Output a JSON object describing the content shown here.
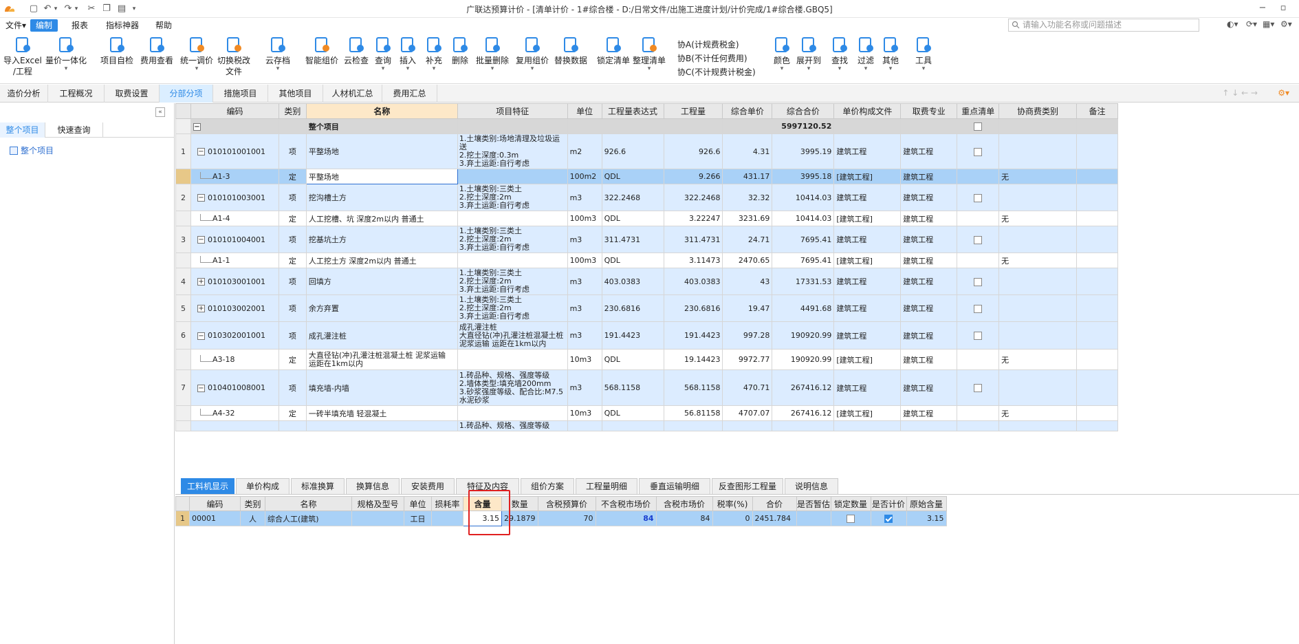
{
  "titlebar": {
    "title": "广联达预算计价 - [清单计价 - 1#综合楼 - D:/日常文件/出施工进度计划/计价完成/1#综合楼.GBQ5]"
  },
  "menubar": {
    "items": [
      "文件▾",
      "编制",
      "报表",
      "指标神器",
      "帮助"
    ],
    "search_placeholder": "请输入功能名称或问题描述"
  },
  "ribbon": {
    "buttons": [
      {
        "label1": "导入Excel",
        "label2": "/工程",
        "icon": "import-excel-icon",
        "color": "#2e8ae6"
      },
      {
        "label1": "量价一体化",
        "label2": "",
        "icon": "quantity-price-icon",
        "color": "#2e8ae6"
      },
      {
        "label1": "项目自检",
        "label2": "",
        "icon": "self-check-icon",
        "color": "#2e8ae6"
      },
      {
        "label1": "费用查看",
        "label2": "",
        "icon": "cost-view-icon",
        "color": "#2e8ae6"
      },
      {
        "label1": "统一调价",
        "label2": "",
        "icon": "unify-price-icon",
        "color": "#f08a24"
      },
      {
        "label1": "切换税改",
        "label2": "文件",
        "icon": "switch-tax-icon",
        "color": "#f08a24"
      },
      {
        "label1": "云存档",
        "label2": "",
        "icon": "cloud-save-icon",
        "color": "#2e8ae6"
      },
      {
        "label1": "智能组价",
        "label2": "",
        "icon": "smart-price-icon",
        "color": "#f08a24"
      },
      {
        "label1": "云检查",
        "label2": "",
        "icon": "cloud-check-icon",
        "color": "#2e8ae6"
      },
      {
        "label1": "查询",
        "label2": "",
        "icon": "query-icon",
        "color": "#2e8ae6"
      },
      {
        "label1": "插入",
        "label2": "",
        "icon": "insert-icon",
        "color": "#2e8ae6"
      },
      {
        "label1": "补充",
        "label2": "",
        "icon": "supplement-icon",
        "color": "#2e8ae6"
      },
      {
        "label1": "删除",
        "label2": "",
        "icon": "delete-icon",
        "color": "#2e8ae6"
      },
      {
        "label1": "批量删除",
        "label2": "",
        "icon": "batch-delete-icon",
        "color": "#2e8ae6"
      },
      {
        "label1": "复用组价",
        "label2": "",
        "icon": "reuse-price-icon",
        "color": "#2e8ae6"
      },
      {
        "label1": "替换数据",
        "label2": "",
        "icon": "replace-data-icon",
        "color": "#2e8ae6"
      },
      {
        "label1": "锁定清单",
        "label2": "",
        "icon": "lock-list-icon",
        "color": "#2e8ae6"
      },
      {
        "label1": "整理清单",
        "label2": "",
        "icon": "organize-list-icon",
        "color": "#f08a24"
      },
      {
        "label1": "颜色",
        "label2": "",
        "icon": "color-icon",
        "color": "#2e8ae6"
      },
      {
        "label1": "展开到",
        "label2": "",
        "icon": "expand-to-icon",
        "color": "#2e8ae6"
      },
      {
        "label1": "查找",
        "label2": "",
        "icon": "find-icon",
        "color": "#2e8ae6"
      },
      {
        "label1": "过滤",
        "label2": "",
        "icon": "filter-icon",
        "color": "#2e8ae6"
      },
      {
        "label1": "其他",
        "label2": "",
        "icon": "other-icon",
        "color": "#2e8ae6"
      },
      {
        "label1": "工具",
        "label2": "",
        "icon": "tools-icon",
        "color": "#2e8ae6"
      }
    ],
    "small_items": [
      "协A(计规费税金)",
      "协B(不计任何费用)",
      "协C(不计规费计税金)"
    ]
  },
  "tabstrip": {
    "tabs": [
      "造价分析",
      "工程概况",
      "取费设置",
      "分部分项",
      "措施项目",
      "其他项目",
      "人材机汇总",
      "费用汇总"
    ],
    "active": 3
  },
  "leftpanel": {
    "tabs": [
      "整个项目",
      "快速查询"
    ],
    "tree_root": "整个项目"
  },
  "maingrid": {
    "headers": [
      "",
      "编码",
      "类别",
      "名称",
      "项目特征",
      "单位",
      "工程量表达式",
      "工程量",
      "综合单价",
      "综合合价",
      "单价构成文件",
      "取费专业",
      "重点清单",
      "协商费类别",
      "备注"
    ],
    "top_row": {
      "name": "整个项目",
      "total": "5997120.52"
    },
    "rows": [
      {
        "rn": "1",
        "type": "item",
        "toggle": "−",
        "code": "010101001001",
        "cat": "项",
        "name": "平整场地",
        "feat": "1.土壤类别:场地清理及垃圾运送\n2.挖土深度:0.3m\n3.弃土运距:自行考虑",
        "unit": "m2",
        "expr": "926.6",
        "qty": "926.6",
        "uprice": "4.31",
        "total": "3995.19",
        "file": "建筑工程",
        "major": "建筑工程",
        "check": true,
        "neg": "",
        "h": 48
      },
      {
        "rn": "",
        "type": "sel",
        "code": "A1-3",
        "cat": "定",
        "name": "平整场地",
        "feat": "",
        "unit": "100m2",
        "expr": "QDL",
        "qty": "9.266",
        "uprice": "431.17",
        "total": "3995.18",
        "file": "[建筑工程]",
        "major": "建筑工程",
        "check": false,
        "neg": "无",
        "h": 22
      },
      {
        "rn": "2",
        "type": "item",
        "toggle": "−",
        "code": "010101003001",
        "cat": "项",
        "name": "挖沟槽土方",
        "feat": "1.土壤类别:三类土\n2.挖土深度:2m\n3.弃土运距:自行考虑",
        "unit": "m3",
        "expr": "322.2468",
        "qty": "322.2468",
        "uprice": "32.32",
        "total": "10414.03",
        "file": "建筑工程",
        "major": "建筑工程",
        "check": true,
        "neg": "",
        "h": 38
      },
      {
        "rn": "",
        "type": "sub",
        "code": "A1-4",
        "cat": "定",
        "name": "人工挖槽、坑 深度2m以内 普通土",
        "feat": "",
        "unit": "100m3",
        "expr": "QDL",
        "qty": "3.22247",
        "uprice": "3231.69",
        "total": "10414.03",
        "file": "[建筑工程]",
        "major": "建筑工程",
        "check": false,
        "neg": "无",
        "h": 22
      },
      {
        "rn": "3",
        "type": "item",
        "toggle": "−",
        "code": "010101004001",
        "cat": "项",
        "name": "挖基坑土方",
        "feat": "1.土壤类别:三类土\n2.挖土深度:2m\n3.弃土运距:自行考虑",
        "unit": "m3",
        "expr": "311.4731",
        "qty": "311.4731",
        "uprice": "24.71",
        "total": "7695.41",
        "file": "建筑工程",
        "major": "建筑工程",
        "check": true,
        "neg": "",
        "h": 38
      },
      {
        "rn": "",
        "type": "sub",
        "code": "A1-1",
        "cat": "定",
        "name": "人工挖土方 深度2m以内 普通土",
        "feat": "",
        "unit": "100m3",
        "expr": "QDL",
        "qty": "3.11473",
        "uprice": "2470.65",
        "total": "7695.41",
        "file": "[建筑工程]",
        "major": "建筑工程",
        "check": false,
        "neg": "无",
        "h": 22
      },
      {
        "rn": "4",
        "type": "item",
        "toggle": "+",
        "code": "010103001001",
        "cat": "项",
        "name": "回填方",
        "feat": "1.土壤类别:三类土\n2.挖土深度:2m\n3.弃土运距:自行考虑",
        "unit": "m3",
        "expr": "403.0383",
        "qty": "403.0383",
        "uprice": "43",
        "total": "17331.53",
        "file": "建筑工程",
        "major": "建筑工程",
        "check": true,
        "neg": "",
        "h": 38
      },
      {
        "rn": "5",
        "type": "item",
        "toggle": "+",
        "code": "010103002001",
        "cat": "项",
        "name": "余方弃置",
        "feat": "1.土壤类别:三类土\n2.挖土深度:2m\n3.弃土运距:自行考虑",
        "unit": "m3",
        "expr": "230.6816",
        "qty": "230.6816",
        "uprice": "19.47",
        "total": "4491.68",
        "file": "建筑工程",
        "major": "建筑工程",
        "check": true,
        "neg": "",
        "h": 38
      },
      {
        "rn": "6",
        "type": "item",
        "toggle": "−",
        "code": "010302001001",
        "cat": "项",
        "name": "成孔灌注桩",
        "feat": "成孔灌注桩\n大直径钻(冲)孔灌注桩混凝土桩 泥浆运输 运距在1km以内",
        "unit": "m3",
        "expr": "191.4423",
        "qty": "191.4423",
        "uprice": "997.28",
        "total": "190920.99",
        "file": "建筑工程",
        "major": "建筑工程",
        "check": true,
        "neg": "",
        "h": 40
      },
      {
        "rn": "",
        "type": "sub",
        "code": "A3-18",
        "cat": "定",
        "name": "大直径钻(冲)孔灌注桩混凝土桩 泥浆运输 运距在1km以内",
        "feat": "",
        "unit": "10m3",
        "expr": "QDL",
        "qty": "19.14423",
        "uprice": "9972.77",
        "total": "190920.99",
        "file": "[建筑工程]",
        "major": "建筑工程",
        "check": false,
        "neg": "无",
        "h": 30,
        "wrapname": true
      },
      {
        "rn": "7",
        "type": "item",
        "toggle": "−",
        "code": "010401008001",
        "cat": "项",
        "name": "填充墙-内墙",
        "feat": "1.砖品种、规格、强度等级\n2.墙体类型:填充墙200mm\n3.砂浆强度等级、配合比:M7.5水泥砂浆",
        "unit": "m3",
        "expr": "568.1158",
        "qty": "568.1158",
        "uprice": "470.71",
        "total": "267416.12",
        "file": "建筑工程",
        "major": "建筑工程",
        "check": true,
        "neg": "",
        "h": 52
      },
      {
        "rn": "",
        "type": "sub",
        "code": "A4-32",
        "cat": "定",
        "name": "一砖半填充墙 轻混凝土",
        "feat": "",
        "unit": "10m3",
        "expr": "QDL",
        "qty": "56.81158",
        "uprice": "4707.07",
        "total": "267416.12",
        "file": "[建筑工程]",
        "major": "建筑工程",
        "check": false,
        "neg": "无",
        "h": 22
      },
      {
        "rn": "",
        "type": "item",
        "toggle": "",
        "code": "",
        "cat": "",
        "name": "",
        "feat": "1.砖品种、规格、强度等级",
        "unit": "",
        "expr": "",
        "qty": "",
        "uprice": "",
        "total": "",
        "file": "",
        "major": "",
        "check": false,
        "neg": "",
        "h": 14
      }
    ]
  },
  "bottomtabs": {
    "tabs": [
      "工料机显示",
      "单价构成",
      "标准换算",
      "换算信息",
      "安装费用",
      "特征及内容",
      "组价方案",
      "工程量明细",
      "垂直运输明细",
      "反查图形工程量",
      "说明信息"
    ],
    "active": 0
  },
  "subgrid": {
    "headers": [
      "",
      "编码",
      "类别",
      "名称",
      "规格及型号",
      "单位",
      "损耗率",
      "含量",
      "数量",
      "含税预算价",
      "不含税市场价",
      "含税市场价",
      "税率(%)",
      "合价",
      "是否暂估",
      "锁定数量",
      "是否计价",
      "原始含量"
    ],
    "row": {
      "rn": "1",
      "code": "00001",
      "cat": "人",
      "name": "综合人工(建筑)",
      "spec": "",
      "unit": "工日",
      "loss": "",
      "content": "3.15",
      "qty": "29.1879",
      "budget": "70",
      "market_ex": "84",
      "market_in": "84",
      "tax": "0",
      "total": "2451.784",
      "estimate": "",
      "lock": false,
      "priced": true,
      "orig": "3.15"
    }
  },
  "colors": {
    "accent": "#2e8ae6",
    "highlight_box": "#e02020",
    "row_blue": "#dcecff",
    "row_selected": "#a9d1f7"
  }
}
